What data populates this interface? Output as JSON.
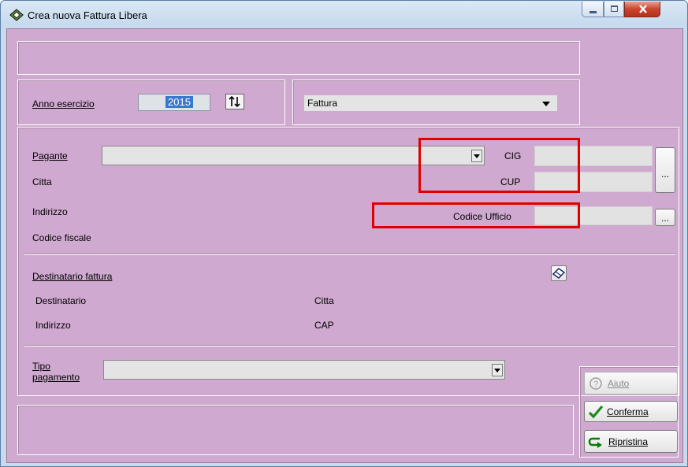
{
  "window": {
    "title": "Crea nuova Fattura Libera"
  },
  "header": {
    "anno_label": "Anno esercizio",
    "anno_value": "2015",
    "tipo_doc_value": "Fattura"
  },
  "pagante": {
    "label": "Pagante",
    "citta_label": "Citta",
    "indirizzo_label": "Indirizzo",
    "codice_fiscale_label": "Codice fiscale",
    "cig_label": "CIG",
    "cup_label": "CUP",
    "codice_ufficio_label": "Codice Ufficio",
    "browse_label": "..."
  },
  "destinatario": {
    "section_label": "Destinatario fattura",
    "destinatario_label": "Destinatario",
    "indirizzo_label": "Indirizzo",
    "citta_label": "Citta",
    "cap_label": "CAP"
  },
  "pagamento": {
    "label_line1": "Tipo",
    "label_line2": "pagamento"
  },
  "buttons": {
    "aiuto": "Aiuto",
    "conferma": "Conferma",
    "ripristina": "Ripristina"
  },
  "colors": {
    "background": "#cfa9cf",
    "highlight": "#e00000"
  }
}
